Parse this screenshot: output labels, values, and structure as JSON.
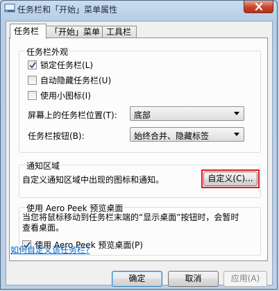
{
  "window": {
    "title": "任务栏和「开始」菜单属性",
    "app_icon": "taskbar-icon",
    "close_icon": "close-icon"
  },
  "tabs": [
    {
      "label": "任务栏",
      "active": true
    },
    {
      "label": "「开始」菜单",
      "active": false
    },
    {
      "label": "工具栏",
      "active": false
    }
  ],
  "appearance": {
    "legend": "任务栏外观",
    "lock": {
      "label": "锁定任务栏(L)",
      "checked": true
    },
    "autohide": {
      "label": "自动隐藏任务栏(U)",
      "checked": false
    },
    "small_icons": {
      "label": "使用小图标(I)",
      "checked": false
    },
    "location_label": "屏幕上的任务栏位置(T):",
    "location_value": "底部",
    "buttons_label": "任务栏按钮(B):",
    "buttons_value": "始终合并、隐藏标签"
  },
  "notification": {
    "legend": "通知区域",
    "text": "自定义通知区域中出现的图标和通知。",
    "customize_button": "自定义(C)..."
  },
  "peek": {
    "legend": "使用 Aero Peek 预览桌面",
    "desc_line1": "当您将鼠标移动到任务栏末端的“显示桌面”按钮时，会暂时",
    "desc_line2": "查看桌面。",
    "checkbox": {
      "label": "使用 Aero Peek 预览桌面(P)",
      "checked": true
    }
  },
  "help_link": "如何自定义该任务栏?",
  "buttons": {
    "ok": "确定",
    "cancel": "取消",
    "apply": "应用(A)"
  },
  "colors": {
    "highlight": "#e2161d",
    "link": "#0066cc"
  }
}
